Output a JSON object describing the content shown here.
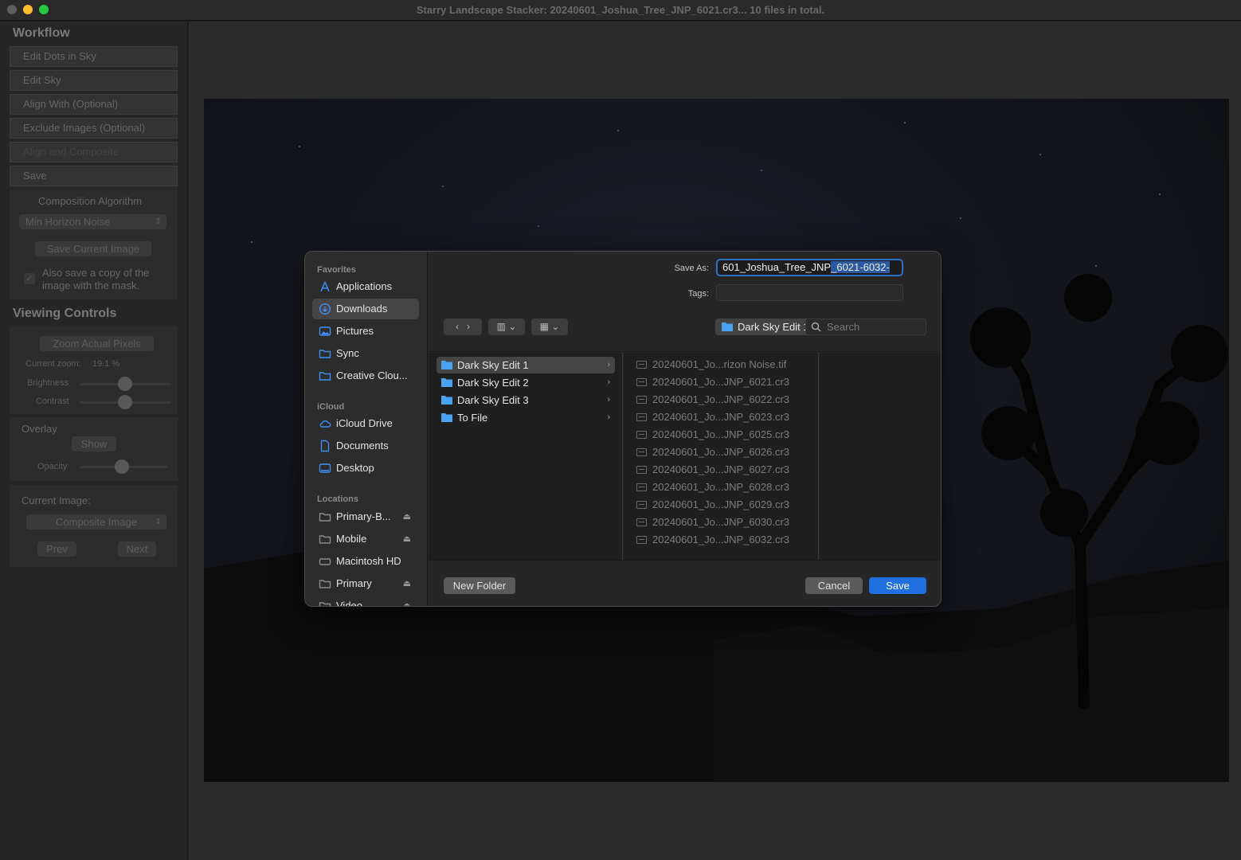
{
  "window": {
    "title": "Starry Landscape Stacker: 20240601_Joshua_Tree_JNP_6021.cr3...  10 files in total."
  },
  "sidebar": {
    "workflow_heading": "Workflow",
    "workflow_buttons": [
      "Edit Dots in Sky",
      "Edit Sky",
      "Align With (Optional)",
      "Exclude Images (Optional)",
      "Align and Composite",
      "Save"
    ],
    "composition_label": "Composition Algorithm",
    "composition_value": "Min Horizon Noise",
    "save_current_label": "Save Current Image",
    "also_save_label": "Also save a copy of the image with the mask.",
    "viewing_heading": "Viewing Controls",
    "zoom_actual_label": "Zoom Actual Pixels",
    "current_zoom_label": "Current zoom:",
    "current_zoom_value": "19.1 %",
    "brightness_label": "Brightness",
    "contrast_label": "Contrast",
    "overlay_label": "Overlay",
    "show_label": "Show",
    "opacity_label": "Opacity",
    "current_image_label": "Current Image:",
    "current_image_value": "Composite Image",
    "prev_label": "Prev",
    "next_label": "Next"
  },
  "dialog": {
    "sections": {
      "favorites": "Favorites",
      "icloud": "iCloud",
      "locations": "Locations"
    },
    "favorites": [
      "Applications",
      "Downloads",
      "Pictures",
      "Sync",
      "Creative Clou..."
    ],
    "icloud": [
      "iCloud Drive",
      "Documents",
      "Desktop"
    ],
    "locations": [
      "Primary-B...",
      "Mobile",
      "Macintosh HD",
      "Primary",
      "Video"
    ],
    "save_as_label": "Save As:",
    "save_as_value_plain": "601_Joshua_Tree_JNP",
    "save_as_value_selected": "_6021-6032-",
    "tags_label": "Tags:",
    "location": "Dark Sky Edit 1",
    "search_placeholder": "Search",
    "folders": [
      "Dark Sky Edit 1",
      "Dark Sky Edit 2",
      "Dark Sky Edit 3",
      "To File"
    ],
    "files": [
      "20240601_Jo...rizon Noise.tif",
      "20240601_Jo...JNP_6021.cr3",
      "20240601_Jo...JNP_6022.cr3",
      "20240601_Jo...JNP_6023.cr3",
      "20240601_Jo...JNP_6025.cr3",
      "20240601_Jo...JNP_6026.cr3",
      "20240601_Jo...JNP_6027.cr3",
      "20240601_Jo...JNP_6028.cr3",
      "20240601_Jo...JNP_6029.cr3",
      "20240601_Jo...JNP_6030.cr3",
      "20240601_Jo...JNP_6032.cr3"
    ],
    "new_folder_label": "New Folder",
    "cancel_label": "Cancel",
    "save_label": "Save"
  },
  "colors": {
    "accent": "#1f6fe0",
    "folder": "#4aa3f0"
  }
}
